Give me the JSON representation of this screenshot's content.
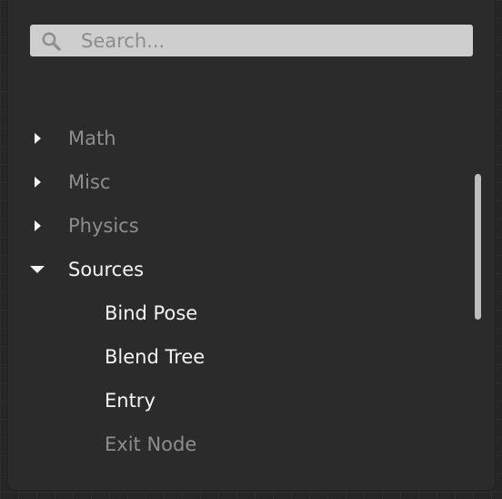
{
  "search": {
    "placeholder": "Search...",
    "value": ""
  },
  "tree": {
    "categories": [
      {
        "label": "Math",
        "expanded": false
      },
      {
        "label": "Misc",
        "expanded": false
      },
      {
        "label": "Physics",
        "expanded": false
      },
      {
        "label": "Sources",
        "expanded": true
      }
    ],
    "sources_children": [
      {
        "label": "Bind Pose",
        "enabled": true
      },
      {
        "label": "Blend Tree",
        "enabled": true
      },
      {
        "label": "Entry",
        "enabled": true
      },
      {
        "label": "Exit Node",
        "enabled": false
      }
    ]
  },
  "colors": {
    "panel": "#2b2b2b",
    "background": "#262626",
    "search_field": "#cecece",
    "text_bright": "#f4f4f4",
    "text_dim": "#8e8e8e",
    "scrollbar": "#bdbdbd"
  },
  "icons": {
    "search": "magnifier-icon",
    "collapsed": "caret-right-icon",
    "expanded": "caret-down-icon"
  }
}
